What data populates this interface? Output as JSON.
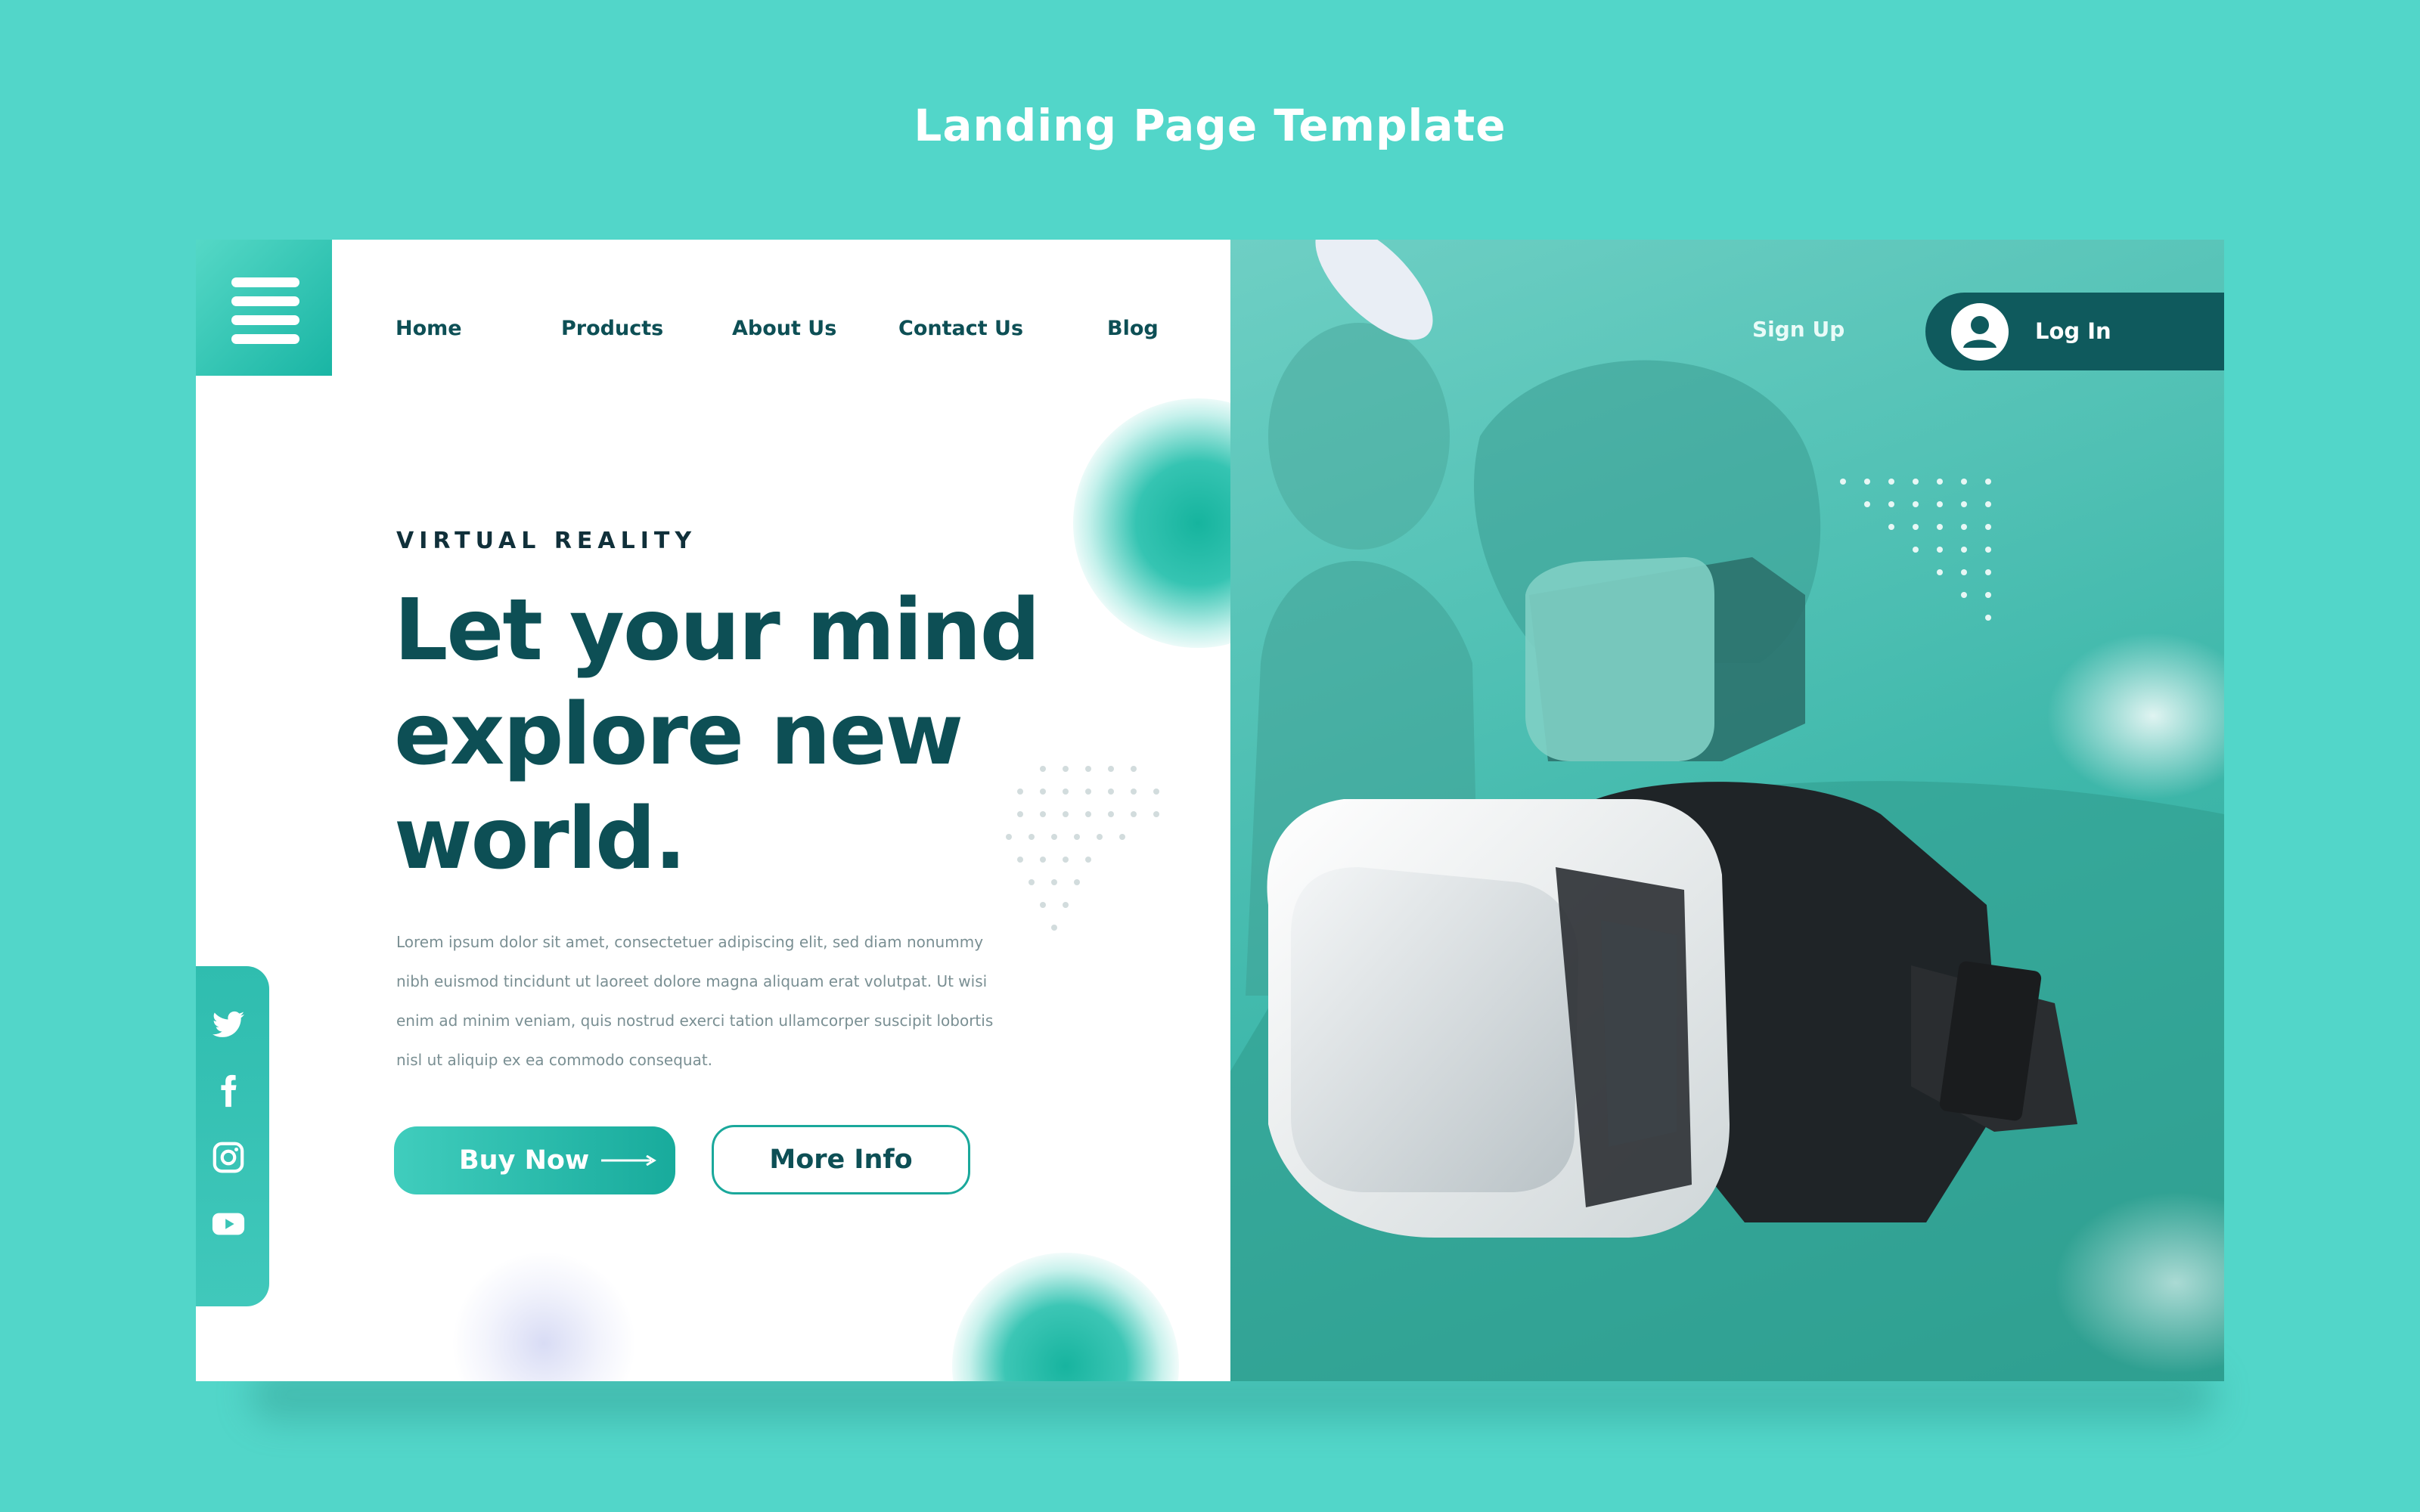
{
  "page": {
    "title": "Landing Page Template"
  },
  "nav": {
    "items": [
      {
        "label": "Home"
      },
      {
        "label": "Products"
      },
      {
        "label": "About Us"
      },
      {
        "label": "Contact Us"
      },
      {
        "label": "Blog"
      }
    ],
    "signup_label": "Sign Up",
    "login_label": "Log In"
  },
  "hero": {
    "eyebrow": "VIRTUAL REALITY",
    "headline_lines": [
      "Let your mind",
      "explore new",
      "world."
    ],
    "body": "Lorem ipsum dolor sit amet, consectetuer adipiscing elit, sed diam nonummy nibh euismod tincidunt ut laoreet dolore magna aliquam erat volutpat. Ut wisi enim ad minim veniam, quis nostrud exerci tation ullamcorper suscipit lobortis nisl ut aliquip ex ea commodo consequat.",
    "body_lines": [
      "Lorem ipsum dolor sit amet, consectetuer adipiscing elit, sed diam nonummy",
      "nibh euismod tincidunt ut laoreet dolore magna aliquam erat volutpat. Ut wisi",
      "enim ad minim veniam, quis nostrud exerci tation ullamcorper suscipit lobortis",
      "nisl ut aliquip ex ea commodo consequat."
    ],
    "buy_label": "Buy Now",
    "more_label": "More Info"
  },
  "social": {
    "icons": [
      "twitter-icon",
      "facebook-icon",
      "instagram-icon",
      "youtube-icon"
    ]
  },
  "colors": {
    "background": "#52d6c9",
    "primary_dark": "#0d4f55",
    "accent": "#1fb5a5",
    "login_pill": "#0f5a5d"
  }
}
